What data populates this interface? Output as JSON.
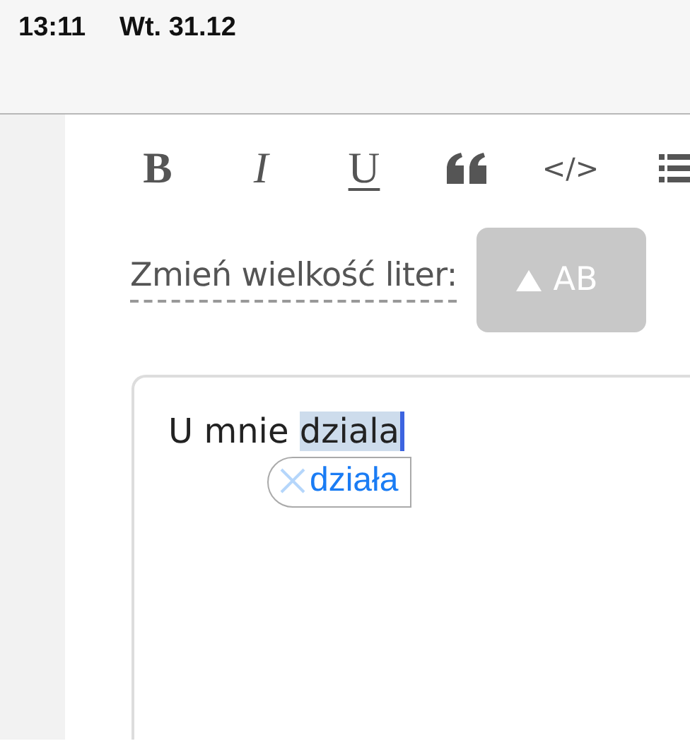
{
  "status_bar": {
    "time": "13:11",
    "date": "Wt. 31.12"
  },
  "toolbar": [
    {
      "kind": "bold",
      "label": "B"
    },
    {
      "kind": "italic",
      "label": "I"
    },
    {
      "kind": "underline",
      "label": "U"
    },
    {
      "kind": "quote"
    },
    {
      "kind": "code",
      "label": "</>"
    },
    {
      "kind": "list"
    }
  ],
  "case_change": {
    "label": "Zmień wielkość liter:",
    "button": "AB"
  },
  "editor": {
    "text": "U mnie ",
    "selected_text": "dziala",
    "suggestion": "działa"
  }
}
